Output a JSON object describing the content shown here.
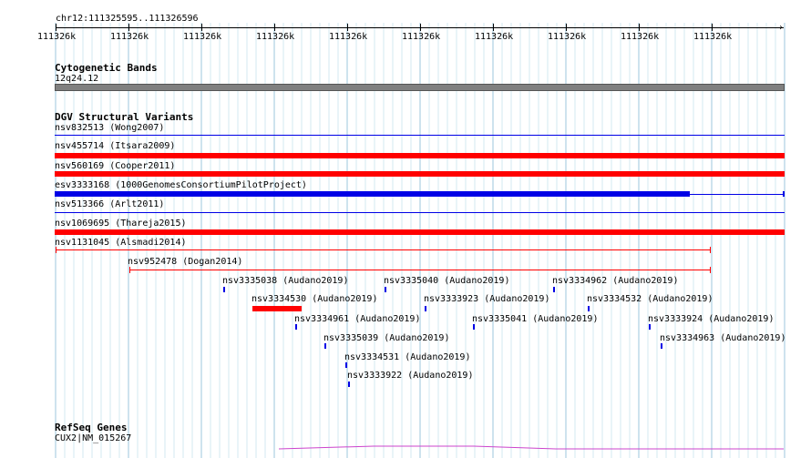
{
  "ruler": {
    "position": "chr12:111325595..111326596",
    "ticks": [
      "111326k",
      "111326k",
      "111326k",
      "111326k",
      "111326k",
      "111326k",
      "111326k",
      "111326k",
      "111326k",
      "111326k"
    ]
  },
  "cytoband": {
    "title": "Cytogenetic Bands",
    "band": "12q24.12"
  },
  "dgv": {
    "title": "DGV Structural Variants",
    "features": [
      "nsv832513 (Wong2007)",
      "nsv455714 (Itsara2009)",
      "nsv560169 (Cooper2011)",
      "esv3333168 (1000GenomesConsortiumPilotProject)",
      "nsv513366 (Arlt2011)",
      "nsv1069695 (Thareja2015)",
      "nsv1131045 (Alsmadi2014)",
      "nsv952478 (Dogan2014)",
      "nsv3335038 (Audano2019)",
      "nsv3335040 (Audano2019)",
      "nsv3334962 (Audano2019)",
      "nsv3334530 (Audano2019)",
      "nsv3333923 (Audano2019)",
      "nsv3334532 (Audano2019)",
      "nsv3334961 (Audano2019)",
      "nsv3335041 (Audano2019)",
      "nsv3333924 (Audano2019)",
      "nsv3335039 (Audano2019)",
      "nsv3334963 (Audano2019)",
      "nsv3334531 (Audano2019)",
      "nsv3333922 (Audano2019)"
    ]
  },
  "refseq": {
    "title": "RefSeq Genes",
    "gene": "CUX2|NM_015267"
  },
  "colors": {
    "loss": "#ff0000",
    "gain": "#0000e6",
    "grid": "#add8e6",
    "cytoband": "#808080",
    "gene": "#cc44cc"
  }
}
